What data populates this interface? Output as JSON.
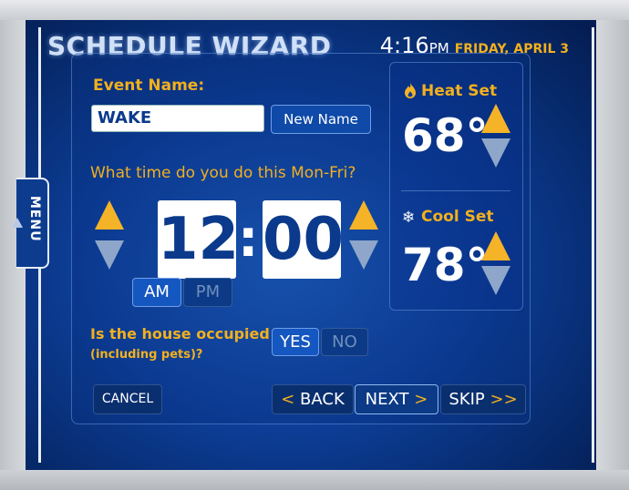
{
  "header": {
    "title": "SCHEDULE WIZARD",
    "time": "4:16",
    "ampm": "PM",
    "date": "FRIDAY, APRIL 3"
  },
  "menu": {
    "label": "MENU"
  },
  "event": {
    "label": "Event Name:",
    "value": "WAKE",
    "new_name_button": "New Name"
  },
  "time_question": "What time do you do this Mon-Fri?",
  "time_set": {
    "hour": "12",
    "minute": "00",
    "am_label": "AM",
    "pm_label": "PM",
    "selected": "AM"
  },
  "occupied": {
    "question": "Is the house occupied",
    "subtext": "(including pets)?",
    "yes_label": "YES",
    "no_label": "NO",
    "selected": "YES"
  },
  "nav": {
    "cancel": "CANCEL",
    "back": "BACK",
    "back_arrow": "<",
    "next": "NEXT",
    "next_arrow": ">",
    "skip": "SKIP",
    "skip_arrow": ">>"
  },
  "heat": {
    "label": "Heat Set",
    "value": "68°",
    "icon": "flame-icon"
  },
  "cool": {
    "label": "Cool Set",
    "value": "78°",
    "icon": "snowflake-icon"
  },
  "colors": {
    "accent": "#f2b01e",
    "screen": "#0d3e98",
    "digit": "#0b3a8c"
  }
}
